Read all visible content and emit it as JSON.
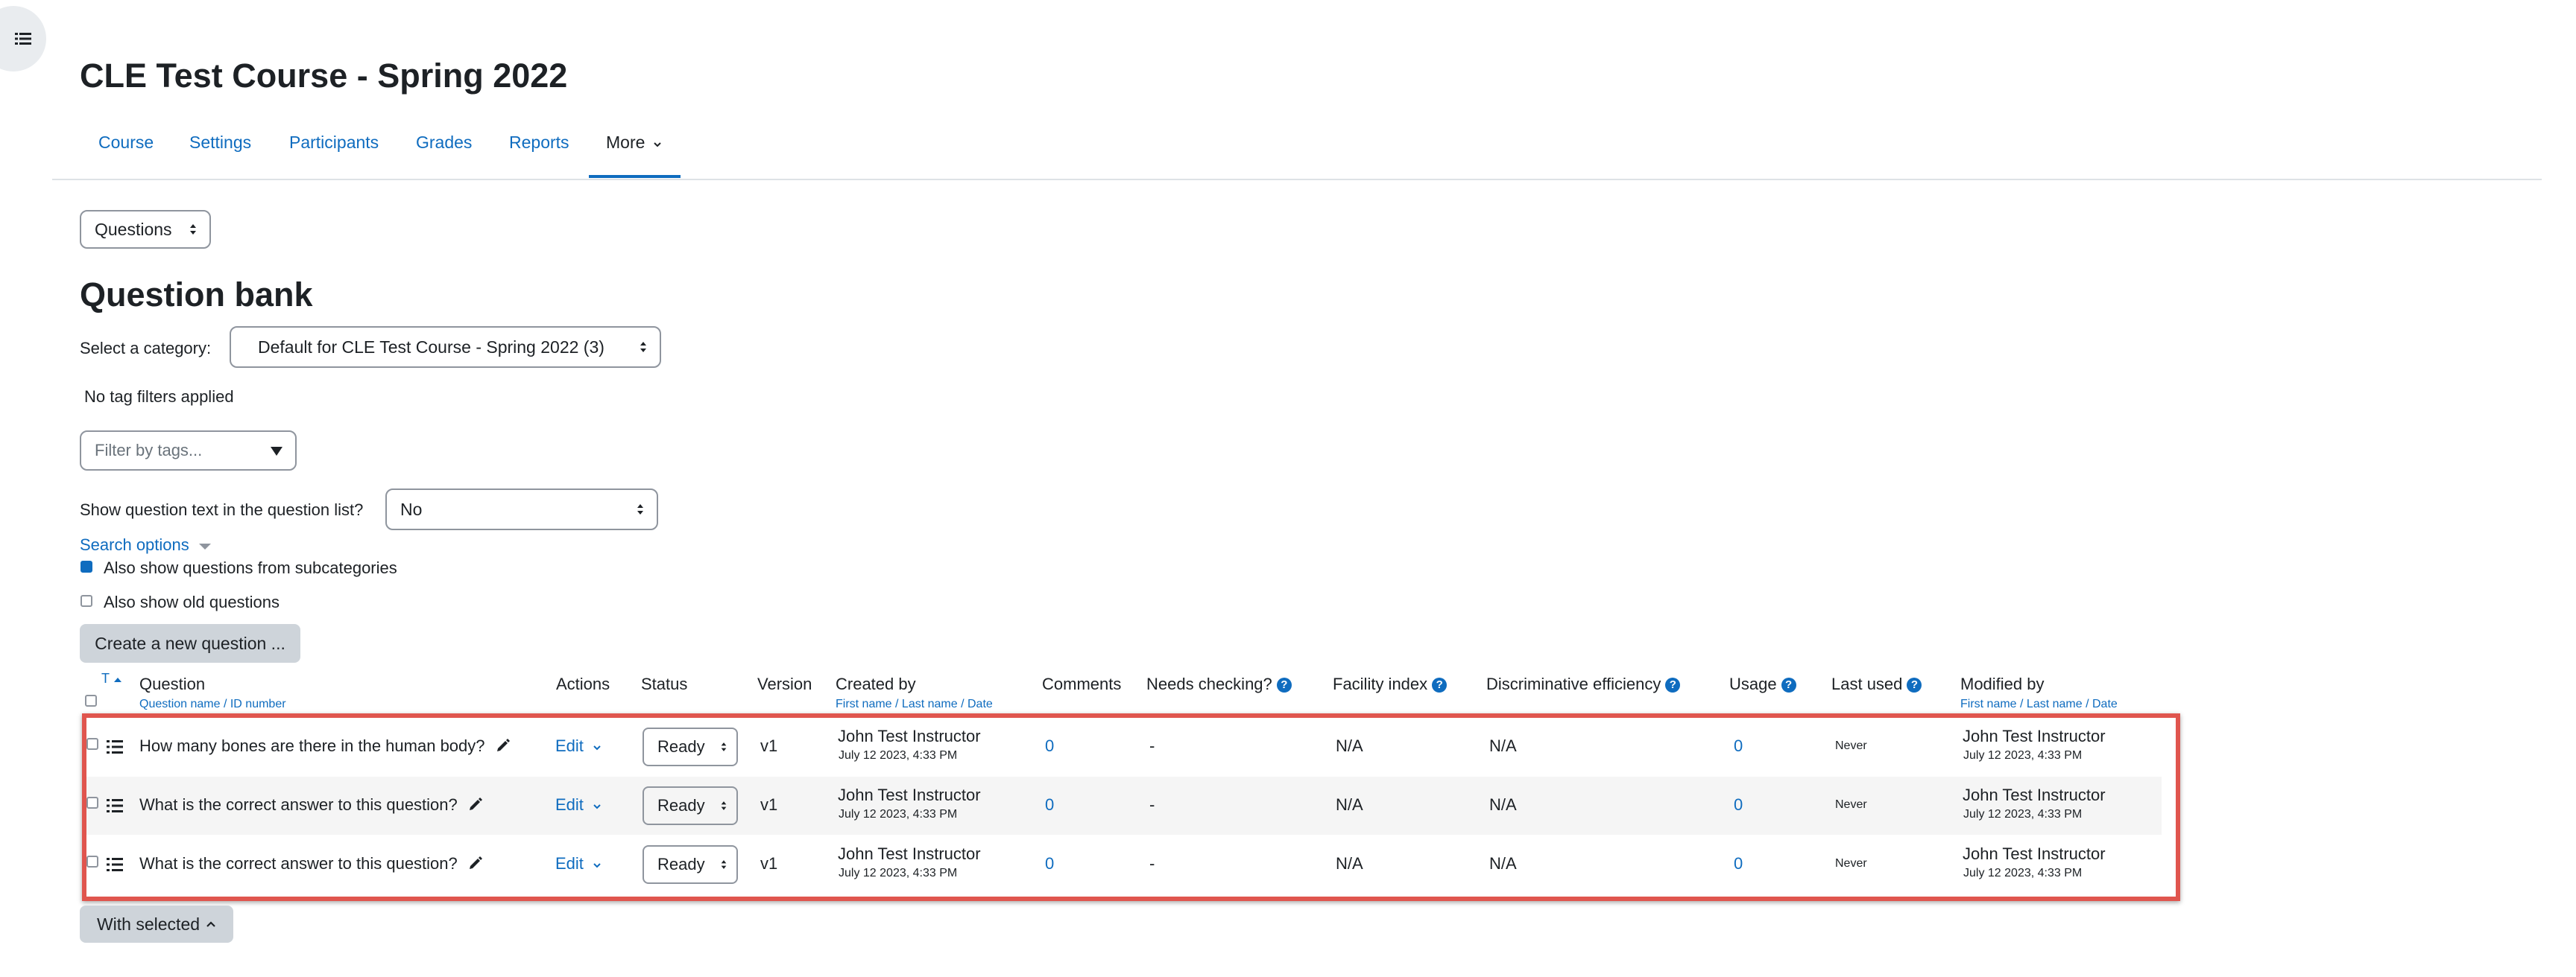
{
  "course": {
    "title": "CLE Test Course - Spring 2022"
  },
  "nav": {
    "items": [
      "Course",
      "Settings",
      "Participants",
      "Grades",
      "Reports"
    ],
    "more": "More"
  },
  "page_select": {
    "value": "Questions"
  },
  "bank": {
    "heading": "Question bank",
    "category_label": "Select a category:",
    "category_value": "Default for CLE Test Course - Spring 2022 (3)",
    "tag_filters_text": "No tag filters applied",
    "filter_placeholder": "Filter by tags...",
    "show_text_label": "Show question text in the question list?",
    "show_text_value": "No",
    "search_options": "Search options",
    "subcategories_label": "Also show questions from subcategories",
    "subcategories_checked": true,
    "old_questions_label": "Also show old questions",
    "old_questions_checked": false,
    "create_button": "Create a new question ...",
    "with_selected": "With selected"
  },
  "table": {
    "headers": {
      "type": "T",
      "question": "Question",
      "question_sub_name": "Question name",
      "question_sub_id": "ID number",
      "actions": "Actions",
      "status": "Status",
      "version": "Version",
      "created_by": "Created by",
      "created_sub_first": "First name",
      "created_sub_last": "Last name",
      "created_sub_date": "Date",
      "comments": "Comments",
      "needs_checking": "Needs checking?",
      "facility": "Facility index",
      "discriminative": "Discriminative efficiency",
      "usage": "Usage",
      "last_used": "Last used",
      "modified_by": "Modified by",
      "modified_sub_first": "First name",
      "modified_sub_last": "Last name",
      "modified_sub_date": "Date"
    },
    "rows": [
      {
        "question": "How many bones are there in the human body?",
        "action": "Edit",
        "status": "Ready",
        "version": "v1",
        "created_name": "John Test Instructor",
        "created_date": "July 12 2023, 4:33 PM",
        "comments": "0",
        "needs_checking": "-",
        "facility": "N/A",
        "discriminative": "N/A",
        "usage": "0",
        "last_used": "Never",
        "modified_name": "John Test Instructor",
        "modified_date": "July 12 2023, 4:33 PM"
      },
      {
        "question": "What is the correct answer to this question?",
        "action": "Edit",
        "status": "Ready",
        "version": "v1",
        "created_name": "John Test Instructor",
        "created_date": "July 12 2023, 4:33 PM",
        "comments": "0",
        "needs_checking": "-",
        "facility": "N/A",
        "discriminative": "N/A",
        "usage": "0",
        "last_used": "Never",
        "modified_name": "John Test Instructor",
        "modified_date": "July 12 2023, 4:33 PM"
      },
      {
        "question": "What is the correct answer to this question?",
        "action": "Edit",
        "status": "Ready",
        "version": "v1",
        "created_name": "John Test Instructor",
        "created_date": "July 12 2023, 4:33 PM",
        "comments": "0",
        "needs_checking": "-",
        "facility": "N/A",
        "discriminative": "N/A",
        "usage": "0",
        "last_used": "Never",
        "modified_name": "John Test Instructor",
        "modified_date": "July 12 2023, 4:33 PM"
      }
    ]
  },
  "colors": {
    "accent": "#0f6cbf",
    "highlight": "#e0554e",
    "button_grey": "#ced4da"
  }
}
